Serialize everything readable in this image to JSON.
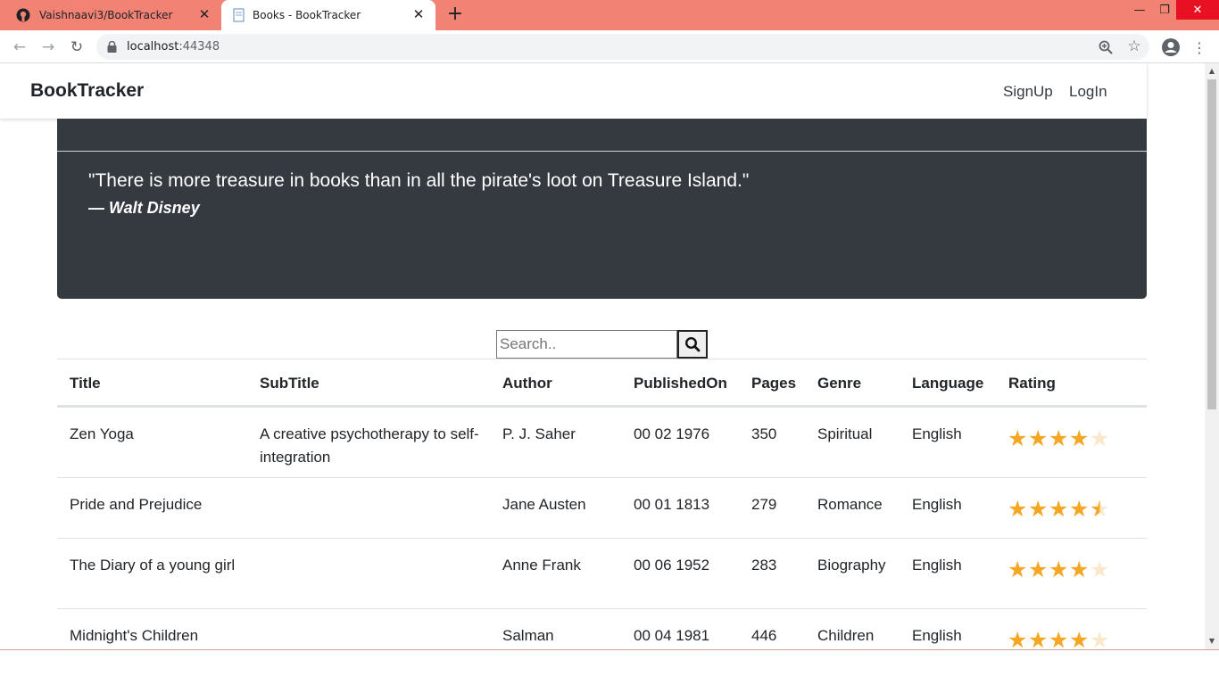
{
  "browser": {
    "tabs": [
      {
        "label": "Vaishnaavi3/BookTracker",
        "icon": "github-icon"
      },
      {
        "label": "Books - BookTracker",
        "icon": "page-icon"
      }
    ],
    "url_host": "localhost",
    "url_port": ":44348",
    "accent_color": "#f28374"
  },
  "navbar": {
    "brand": "BookTracker",
    "links": [
      "SignUp",
      "LogIn"
    ]
  },
  "hero": {
    "quote": "\"There is more treasure in books than in all the pirate's loot on Treasure Island.\"",
    "author": "— Walt Disney"
  },
  "search": {
    "placeholder": "Search..",
    "icon": "search-icon"
  },
  "table": {
    "headers": [
      "Title",
      "SubTitle",
      "Author",
      "PublishedOn",
      "Pages",
      "Genre",
      "Language",
      "Rating"
    ],
    "rows": [
      {
        "title": "Zen Yoga",
        "subtitle": "A creative psychotherapy to self-integration",
        "author": "P. J. Saher",
        "published": "00 02 1976",
        "pages": "350",
        "genre": "Spiritual",
        "language": "English",
        "rating": 4
      },
      {
        "title": "Pride and Prejudice",
        "subtitle": "",
        "author": "Jane Austen",
        "published": "00 01 1813",
        "pages": "279",
        "genre": "Romance",
        "language": "English",
        "rating": 4.5
      },
      {
        "title": "The Diary of a young girl",
        "subtitle": "",
        "author": "Anne Frank",
        "published": "00 06 1952",
        "pages": "283",
        "genre": "Biography",
        "language": "English",
        "rating": 4
      },
      {
        "title": "Midnight's Children",
        "subtitle": "",
        "author": "Salman",
        "published": "00 04 1981",
        "pages": "446",
        "genre": "Children",
        "language": "English",
        "rating": 4
      }
    ],
    "star_color": "#f5a623"
  }
}
